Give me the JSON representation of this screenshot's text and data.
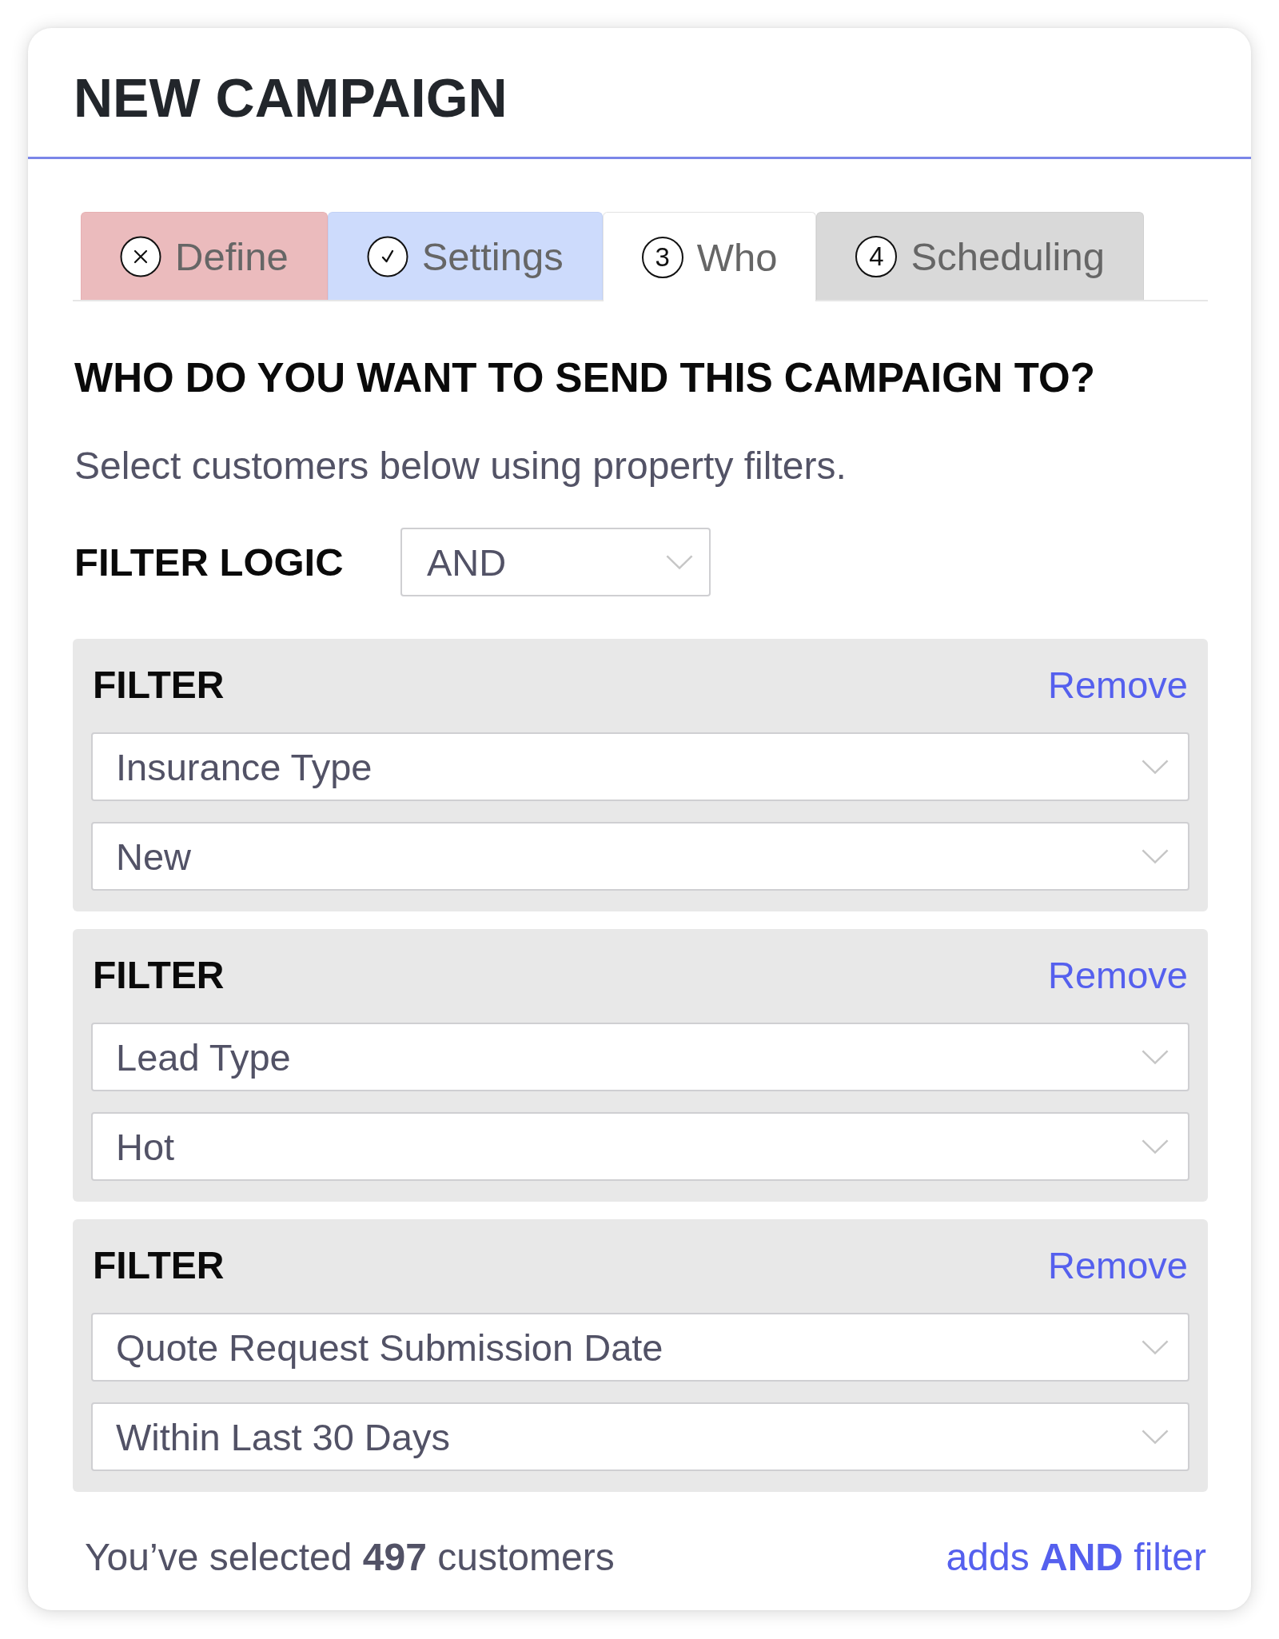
{
  "title": "NEW CAMPAIGN",
  "tabs": [
    {
      "label": "Define",
      "error": true,
      "complete": false,
      "selected": false
    },
    {
      "label": "Settings",
      "error": false,
      "complete": true,
      "selected": false
    },
    {
      "label": "Who",
      "number": "3",
      "error": false,
      "complete": false,
      "selected": true
    },
    {
      "label": "Scheduling",
      "number": "4",
      "error": false,
      "complete": false,
      "selected": false
    }
  ],
  "heading": "WHO DO YOU WANT TO SEND THIS CAMPAIGN TO?",
  "subtitle": "Select customers below using property filters.",
  "filter_logic": {
    "label": "FILTER LOGIC",
    "value": "AND"
  },
  "filters": [
    {
      "title": "FILTER",
      "action": "Remove",
      "property": "Insurance Type",
      "value": "New"
    },
    {
      "title": "FILTER",
      "action": "Remove",
      "property": "Lead Type",
      "value": "Hot"
    },
    {
      "title": "FILTER",
      "action": "Remove",
      "property": "Quote Request Submission Date",
      "value": "Within Last 30 Days"
    }
  ],
  "footer": {
    "summary": "You’ve selected **497** customers",
    "link": "adds **AND** filter"
  }
}
